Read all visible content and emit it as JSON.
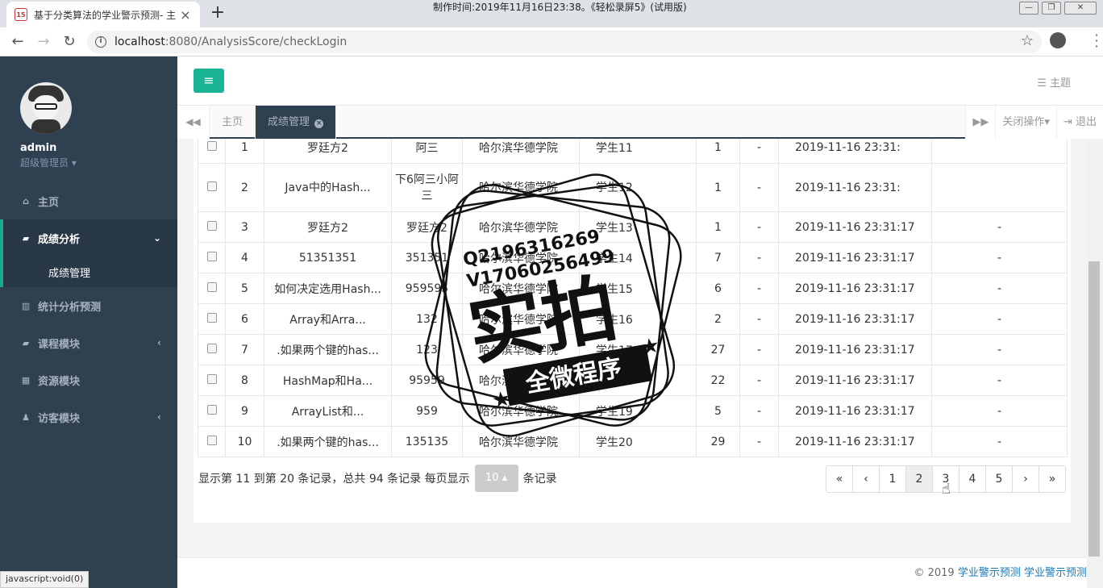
{
  "browser": {
    "tab_title": "基于分类算法的学业警示预测- 主",
    "favicon_text": "15",
    "recorder_text": "制作时间:2019年11月16日23:38。《轻松录屏5》(试用版)",
    "url_host": "localhost",
    "url_path": ":8080/AnalysisScore/checkLogin",
    "status_url": "javascript:void(0)"
  },
  "sidebar": {
    "user_name": "admin",
    "user_role": "超级管理员 ▾",
    "items": [
      {
        "label": "主页",
        "icon": "home-icon"
      },
      {
        "label": "成绩分析",
        "icon": "book-icon"
      },
      {
        "label": "统计分析预测",
        "icon": "bar-chart-icon"
      },
      {
        "label": "课程模块",
        "icon": "book-icon"
      },
      {
        "label": "资源模块",
        "icon": "grid-icon"
      },
      {
        "label": "访客模块",
        "icon": "person-icon"
      }
    ],
    "sub_item": "成绩管理"
  },
  "topnav": {
    "theme_label": "主题"
  },
  "tabs": {
    "home": "主页",
    "active": "成绩管理",
    "close_ops": "关闭操作▾",
    "logout": "退出"
  },
  "table": {
    "rows": [
      {
        "no": "1",
        "name": "罗廷方2",
        "teacher": "阿三",
        "school": "哈尔滨华德学院",
        "student": "学生11",
        "count": "1",
        "dash": "-",
        "time": "2019-11-16 23:31:",
        "last": ""
      },
      {
        "no": "2",
        "name": "Java中的Hash...",
        "teacher": "下6阿三小阿三",
        "school": "哈尔滨华德学院",
        "student": "学生12",
        "count": "1",
        "dash": "-",
        "time": "2019-11-16 23:31:",
        "last": ""
      },
      {
        "no": "3",
        "name": "罗廷方2",
        "teacher": "罗廷方2",
        "school": "哈尔滨华德学院",
        "student": "学生13",
        "count": "1",
        "dash": "-",
        "time": "2019-11-16 23:31:17",
        "last": "-"
      },
      {
        "no": "4",
        "name": "51351351",
        "teacher": "351351",
        "school": "哈尔滨华德学院",
        "student": "学生14",
        "count": "7",
        "dash": "-",
        "time": "2019-11-16 23:31:17",
        "last": "-"
      },
      {
        "no": "5",
        "name": "如何决定选用Hash...",
        "teacher": "959595",
        "school": "哈尔滨华德学院",
        "student": "学生15",
        "count": "6",
        "dash": "-",
        "time": "2019-11-16 23:31:17",
        "last": "-"
      },
      {
        "no": "6",
        "name": "Array和Arra...",
        "teacher": "132",
        "school": "哈尔滨华德学院",
        "student": "学生16",
        "count": "2",
        "dash": "-",
        "time": "2019-11-16 23:31:17",
        "last": "-"
      },
      {
        "no": "7",
        "name": ".如果两个键的has...",
        "teacher": "123",
        "school": "哈尔滨华德学院",
        "student": "学生17",
        "count": "27",
        "dash": "-",
        "time": "2019-11-16 23:31:17",
        "last": "-"
      },
      {
        "no": "8",
        "name": "HashMap和Ha...",
        "teacher": "95959",
        "school": "哈尔滨华德学院",
        "student": "学生18",
        "count": "22",
        "dash": "-",
        "time": "2019-11-16 23:31:17",
        "last": "-"
      },
      {
        "no": "9",
        "name": "ArrayList和...",
        "teacher": "959",
        "school": "哈尔滨华德学院",
        "student": "学生19",
        "count": "5",
        "dash": "-",
        "time": "2019-11-16 23:31:17",
        "last": "-"
      },
      {
        "no": "10",
        "name": ".如果两个键的has...",
        "teacher": "135135",
        "school": "哈尔滨华德学院",
        "student": "学生20",
        "count": "29",
        "dash": "-",
        "time": "2019-11-16 23:31:17",
        "last": "-"
      }
    ]
  },
  "pager": {
    "info_prefix": "显示第 11 到第 20 条记录，总共 94 条记录 每页显示",
    "page_size": "10 ▴",
    "info_suffix": "条记录",
    "pages": [
      "«",
      "‹",
      "1",
      "2",
      "3",
      "4",
      "5",
      "›",
      "»"
    ],
    "current": "2"
  },
  "footer": {
    "copyright": "© 2019 ",
    "link1": "学业警示预测",
    "link2": "学业警示预测"
  },
  "stamp": {
    "qq": "Q2196316269",
    "vx": "V17060256499",
    "big": "实拍",
    "small": "全微程序"
  }
}
